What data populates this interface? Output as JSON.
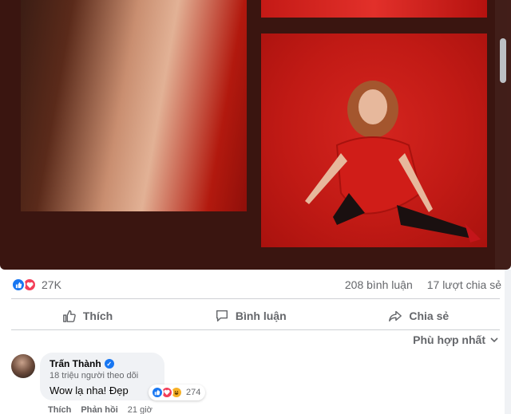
{
  "post": {
    "reaction_count": "27K",
    "comment_count": "208 bình luận",
    "share_count": "17 lượt chia sẻ"
  },
  "actions": {
    "like": "Thích",
    "comment": "Bình luận",
    "share": "Chia sẻ"
  },
  "sort": {
    "label": "Phù hợp nhất"
  },
  "comment": {
    "author": "Trấn Thành",
    "followers": "18 triệu người theo dõi",
    "text": "Wow lạ nha! Đẹp",
    "reaction_count": "274",
    "like_label": "Thích",
    "reply_label": "Phản hồi",
    "time": "21 giờ"
  },
  "colors": {
    "photo_background": "#3a1510",
    "accent_blue": "#1877f2",
    "love_red": "#f33e58",
    "haha_yellow": "#f7b125"
  },
  "icons": [
    "like-icon",
    "love-icon",
    "haha-icon",
    "thumb-up-icon",
    "comment-icon",
    "share-icon",
    "chevron-down-icon",
    "verified-icon"
  ]
}
